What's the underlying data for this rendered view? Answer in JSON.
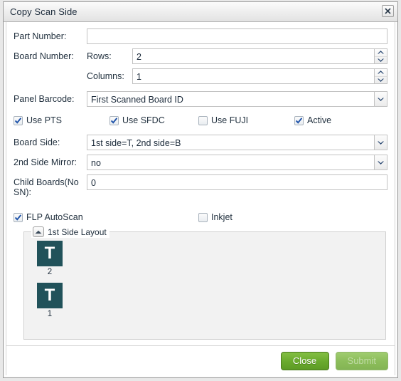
{
  "window": {
    "title": "Copy Scan Side",
    "close_icon": "close-icon"
  },
  "form": {
    "part_number": {
      "label": "Part Number:",
      "value": ""
    },
    "board_number": {
      "label": "Board Number:",
      "rows": {
        "label": "Rows:",
        "value": "2"
      },
      "columns": {
        "label": "Columns:",
        "value": "1"
      }
    },
    "panel_barcode": {
      "label": "Panel Barcode:",
      "value": "First Scanned Board ID"
    },
    "board_side": {
      "label": "Board Side:",
      "value": "1st side=T, 2nd side=B"
    },
    "second_side_mirror": {
      "label": "2nd Side Mirror:",
      "value": "no"
    },
    "child_boards": {
      "label": "Child Boards(No SN):",
      "value": "0"
    }
  },
  "checkboxes_top": [
    {
      "label": "Use PTS",
      "checked": true
    },
    {
      "label": "Use SFDC",
      "checked": true
    },
    {
      "label": "Use FUJI",
      "checked": false
    },
    {
      "label": "Active",
      "checked": true
    }
  ],
  "checkboxes_bottom": [
    {
      "label": "FLP AutoScan",
      "checked": true
    },
    {
      "label": "Inkjet",
      "checked": false
    }
  ],
  "layout_panel": {
    "legend": "1st Side Layout",
    "toggle_icon": "chevron-up-icon",
    "boards": [
      {
        "side": "T",
        "number": "2"
      },
      {
        "side": "T",
        "number": "1"
      }
    ],
    "tile_color": "#21525a"
  },
  "footer": {
    "close_label": "Close",
    "submit_label": "Submit",
    "submit_disabled": true
  },
  "colors": {
    "accent_green": "#6bab2e",
    "tile_teal": "#21525a",
    "text": "#22313f",
    "arrow_navy": "#2c4a73"
  }
}
